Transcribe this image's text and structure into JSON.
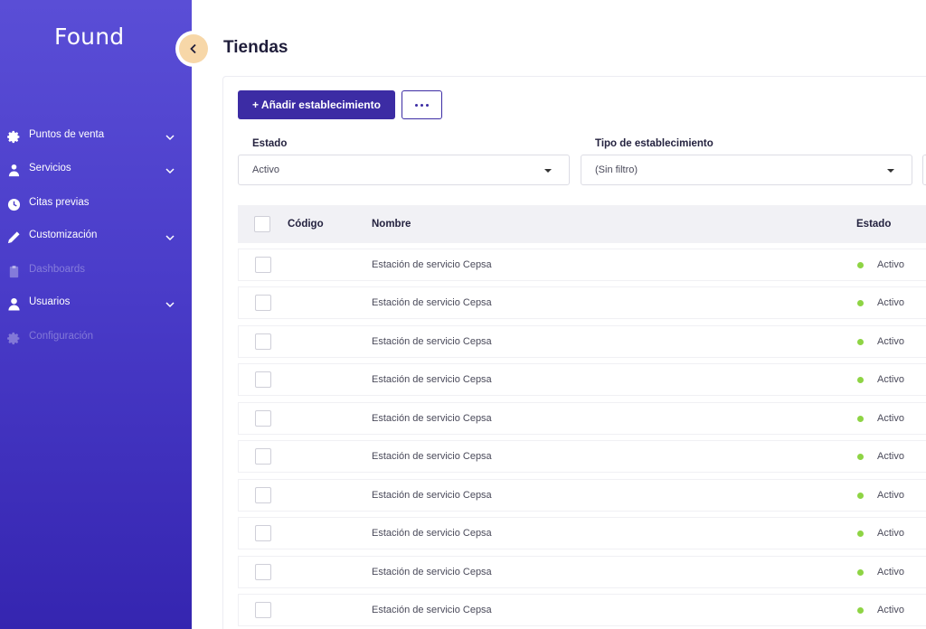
{
  "app": {
    "brand": "Found"
  },
  "sidebar": {
    "items": [
      {
        "label": "Puntos de venta",
        "icon": "gear-icon",
        "dim": false,
        "chevron": true
      },
      {
        "label": "Servicios",
        "icon": "person-service-icon",
        "dim": false,
        "chevron": true
      },
      {
        "label": "Citas previas",
        "icon": "clock-icon",
        "dim": false,
        "chevron": false
      },
      {
        "label": "Customización",
        "icon": "pencil-icon",
        "dim": false,
        "chevron": true
      },
      {
        "label": "Dashboards",
        "icon": "clipboard-icon",
        "dim": true,
        "chevron": false
      },
      {
        "label": "Usuarios",
        "icon": "user-icon",
        "dim": false,
        "chevron": true
      },
      {
        "label": "Configuración",
        "icon": "gear-icon",
        "dim": true,
        "chevron": false
      }
    ]
  },
  "page": {
    "title": "Tiendas"
  },
  "toolbar": {
    "add_label": "+ Añadir establecimiento",
    "more_icon": "more-dots-icon"
  },
  "filters": {
    "estado": {
      "label": "Estado",
      "value": "Activo"
    },
    "tipo": {
      "label": "Tipo de establecimiento",
      "value": "(Sin filtro)"
    }
  },
  "table": {
    "columns": {
      "codigo": "Código",
      "nombre": "Nombre",
      "estado": "Estado"
    },
    "rows": [
      {
        "codigo": "",
        "nombre": "Estación de servicio Cepsa",
        "estado": "Activo"
      },
      {
        "codigo": "",
        "nombre": "Estación de servicio Cepsa",
        "estado": "Activo"
      },
      {
        "codigo": "",
        "nombre": "Estación de servicio Cepsa",
        "estado": "Activo"
      },
      {
        "codigo": "",
        "nombre": "Estación de servicio Cepsa",
        "estado": "Activo"
      },
      {
        "codigo": "",
        "nombre": "Estación de servicio Cepsa",
        "estado": "Activo"
      },
      {
        "codigo": "",
        "nombre": "Estación de servicio Cepsa",
        "estado": "Activo"
      },
      {
        "codigo": "",
        "nombre": "Estación de servicio Cepsa",
        "estado": "Activo"
      },
      {
        "codigo": "",
        "nombre": "Estación de servicio Cepsa",
        "estado": "Activo"
      },
      {
        "codigo": "",
        "nombre": "Estación de servicio Cepsa",
        "estado": "Activo"
      },
      {
        "codigo": "",
        "nombre": "Estación de servicio Cepsa",
        "estado": "Activo"
      }
    ]
  },
  "colors": {
    "sidebar_top": "#5a4ed6",
    "sidebar_bottom": "#3525b0",
    "primary": "#3c2ca4",
    "toggle": "#f7d7a8",
    "status_active": "#8ed444"
  }
}
